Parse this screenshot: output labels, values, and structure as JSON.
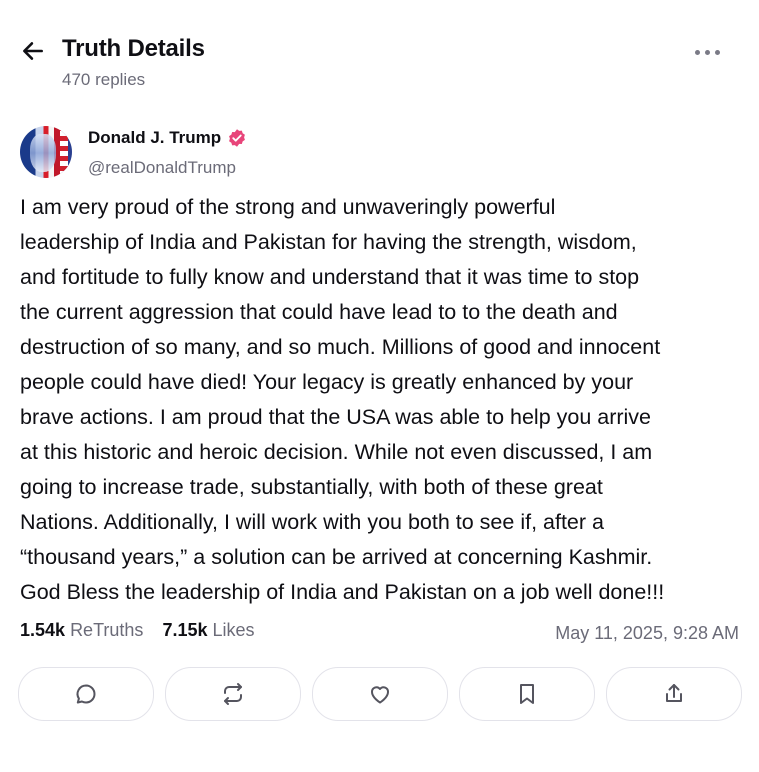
{
  "header": {
    "title": "Truth Details",
    "replies": "470 replies",
    "icons": {
      "back": "arrow-left-icon",
      "more": "more-horizontal-icon"
    }
  },
  "author": {
    "name": "Donald J. Trump",
    "handle": "@realDonaldTrump",
    "verified": true,
    "verified_color": "#e8457a"
  },
  "post": {
    "text": "I am very proud of the strong and unwaveringly powerful\nleadership of India and Pakistan for having the strength, wisdom,\nand fortitude to fully know and understand that it was time to stop\nthe current aggression that could have lead to to the death and\ndestruction of so many, and so much. Millions of good and innocent\npeople could have died! Your legacy is greatly enhanced by your\nbrave actions. I am proud that the USA was able to help you arrive\nat this historic and heroic decision. While not even discussed, I am\ngoing to increase trade, substantially, with both of these great\nNations. Additionally, I will work with you both to see if, after a\n“thousand years,” a solution can be arrived at concerning Kashmir.\nGod Bless the leadership of India and Pakistan on a job well done!!!"
  },
  "stats": {
    "retruths_count": "1.54k",
    "retruths_label": "ReTruths",
    "likes_count": "7.15k",
    "likes_label": "Likes",
    "timestamp": "May 11, 2025, 9:28 AM"
  },
  "actions": [
    {
      "name": "reply",
      "icon": "comment-icon"
    },
    {
      "name": "retruth",
      "icon": "repost-icon"
    },
    {
      "name": "like",
      "icon": "heart-icon"
    },
    {
      "name": "bookmark",
      "icon": "bookmark-icon"
    },
    {
      "name": "share",
      "icon": "share-icon"
    }
  ],
  "colors": {
    "text": "#0f0f14",
    "muted": "#6b6b78",
    "border": "#e3e3ea"
  }
}
